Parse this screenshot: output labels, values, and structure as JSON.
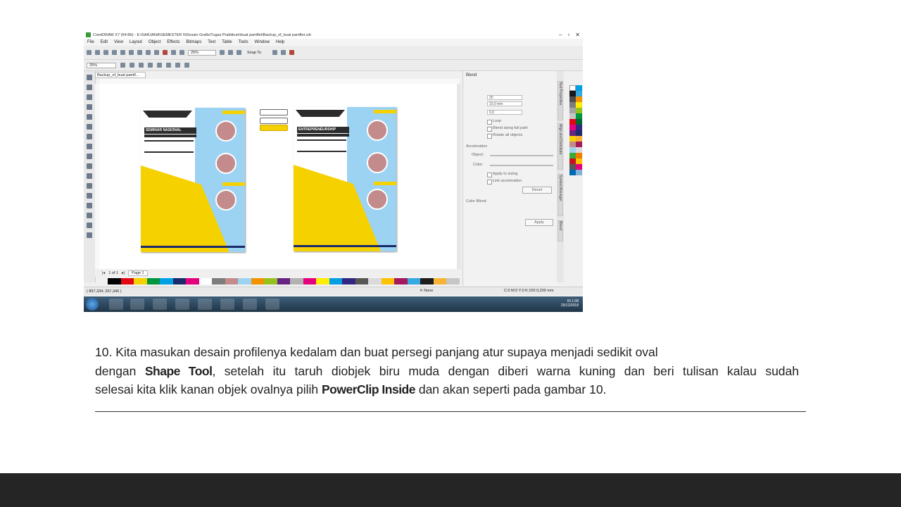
{
  "window": {
    "title": "CorelDRAW X7 (64-Bit) - E:\\SARJANA\\SEMESTER 5\\Desain Grafis\\Tugas Praktikum\\buat pamflet\\Backup_of_buat pamflet.cdr"
  },
  "menu": [
    "File",
    "Edit",
    "View",
    "Layout",
    "Object",
    "Effects",
    "Bitmaps",
    "Text",
    "Table",
    "Tools",
    "Window",
    "Help"
  ],
  "toolbar": {
    "zoom": "25%",
    "snap_label": "Snap To"
  },
  "propbar": {
    "zoom": "25%"
  },
  "document": {
    "tab": "Backup_of_buat pamfl..."
  },
  "page_nav": {
    "count": "1 of 1",
    "tab": "Page 1"
  },
  "pamphlet": {
    "heading": "SEMINAR NASIONAL",
    "subheading": "ENTREPRENEURSHIP"
  },
  "docker": {
    "title": "Blend",
    "steps": "20",
    "spacing": "10,0 mm",
    "angle": "0,0",
    "loop": "Loop",
    "blend_path": "Blend along full path",
    "rotate": "Rotate all objects",
    "acceleration": "Acceleration",
    "object": "Object:",
    "color": "Color:",
    "apply_sizing": "Apply to sizing",
    "link_accel": "Link acceleration",
    "reset": "Reset",
    "color_blend": "Color Blend",
    "apply": "Apply"
  },
  "side_tabs": [
    "Text Properties",
    "Align and Distribute",
    "Symbol Manager",
    "Blend"
  ],
  "status": {
    "coords": "( 897,334; 267,346 )",
    "fill": "None",
    "outline": "C:0 M:0 Y:0 K:100  0,200 mm"
  },
  "taskbar": {
    "lang": "IN",
    "time": "1:08",
    "date": "25/12/2018"
  },
  "caption": {
    "line1": "10. Kita masukan desain profilenya kedalam dan buat persegi panjang atur supaya menjadi sedikit oval",
    "line2_pre": "dengan ",
    "line2_bold": "Shape Tool",
    "line2_post": ", setelah itu taruh diobjek biru muda dengan diberi warna kuning dan beri tulisan kalau sudah",
    "line3_pre": "selesai kita klik kanan objek ovalnya pilih ",
    "line3_bold": "PowerClip Inside",
    "line3_post": " dan akan seperti pada gambar 10."
  },
  "colors": {
    "yellow": "#f6d100",
    "light_blue": "#9dd3f2",
    "navy": "#1a2a6b",
    "footer": "#252525"
  }
}
